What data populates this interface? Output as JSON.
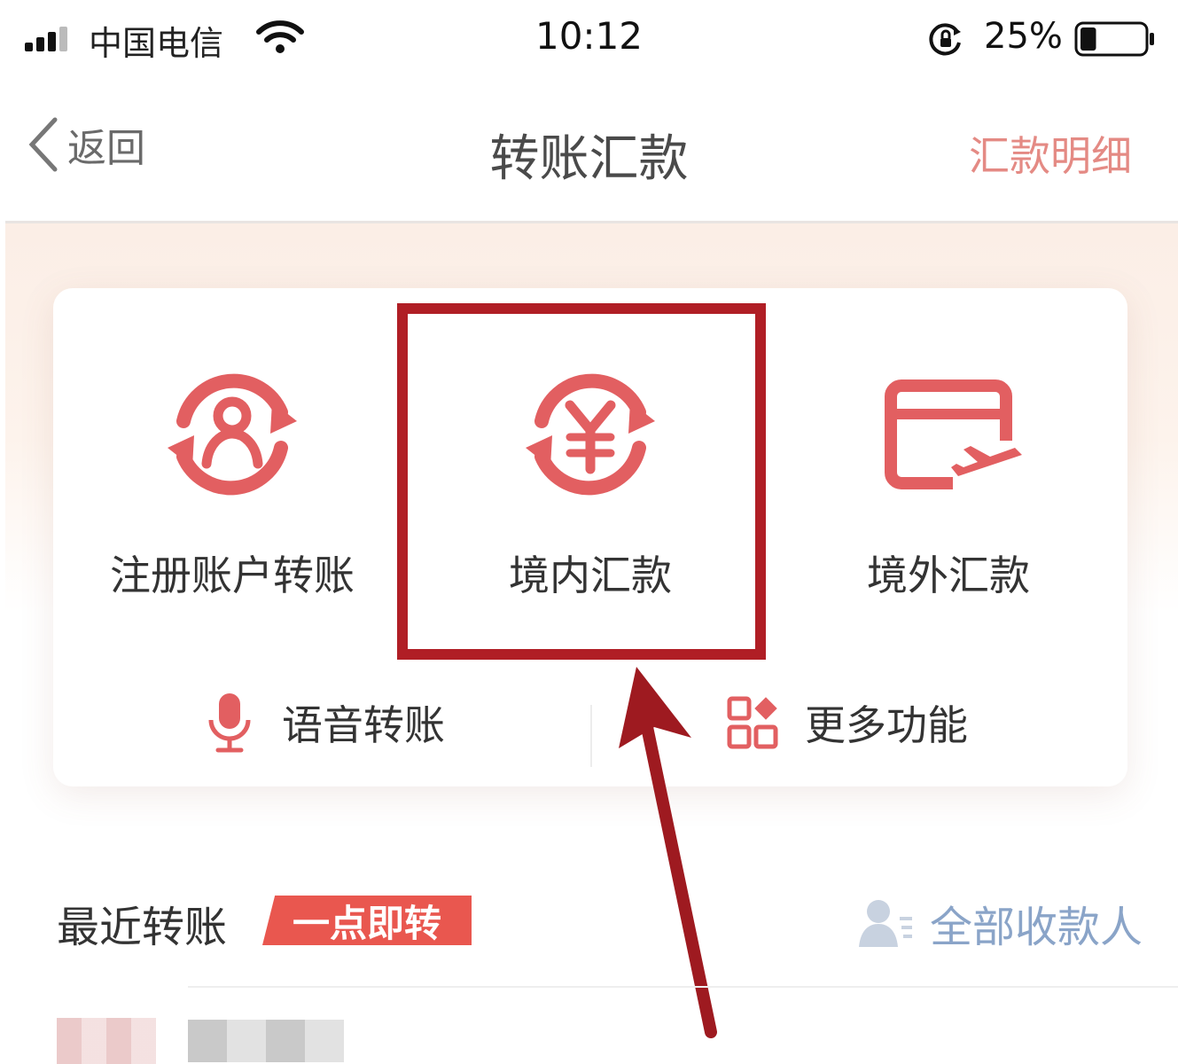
{
  "status_bar": {
    "carrier": "中国电信",
    "time": "10:12",
    "battery_percent": "25%",
    "battery_level": 0.25,
    "icons": [
      "signal-icon",
      "wifi-icon",
      "rotation-lock-icon",
      "battery-icon"
    ]
  },
  "nav": {
    "back_label": "返回",
    "title": "转账汇款",
    "detail_label": "汇款明细"
  },
  "tiles": [
    {
      "label": "注册账户转账",
      "icon": "user-transfer-icon"
    },
    {
      "label": "境内汇款",
      "icon": "yuan-transfer-icon"
    },
    {
      "label": "境外汇款",
      "icon": "card-plane-icon"
    }
  ],
  "sub_actions": [
    {
      "label": "语音转账",
      "icon": "microphone-icon"
    },
    {
      "label": "更多功能",
      "icon": "grid-icon"
    }
  ],
  "recent": {
    "title": "最近转账",
    "badge": "一点即转",
    "all_payees_label": "全部收款人"
  },
  "colors": {
    "accent": "#e9574f",
    "annotation": "#b01e25",
    "icon_red": "#e25f61",
    "link_blue": "#8aa4c8"
  }
}
